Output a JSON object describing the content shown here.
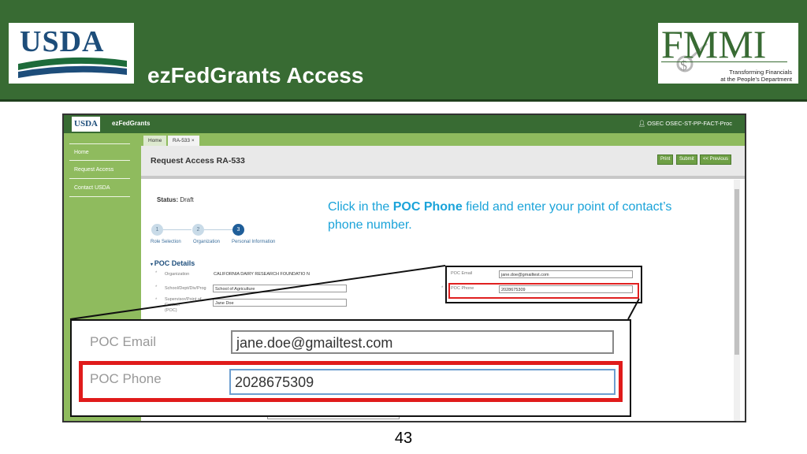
{
  "slide": {
    "title": "ezFedGrants Access",
    "page_number": "43",
    "usda_logo": "USDA",
    "fmmi_logo": "FMMI",
    "fmmi_tagline_1": "Transforming Financials",
    "fmmi_tagline_2": "at the People’s Department"
  },
  "app": {
    "logo": "USDA",
    "name": "ezFedGrants",
    "user": "OSEC OSEC-ST-PP-FACT-Proc",
    "sidebar": [
      "Home",
      "Request Access",
      "Contact USDA"
    ],
    "tabs": [
      "Home",
      "RA-533 ×"
    ],
    "page_title": "Request Access RA-533",
    "buttons": {
      "print": "Print",
      "submit": "Submit",
      "previous": "<< Previous"
    },
    "status_label": "Status:",
    "status_value": "Draft",
    "steps": [
      {
        "number": "1",
        "label": "Role Selection"
      },
      {
        "number": "2",
        "label": "Organization"
      },
      {
        "number": "3",
        "label": "Personal Information"
      }
    ],
    "poc_heading": "POC Details",
    "fields": {
      "organization_label": "Organization",
      "organization_value": "CALIFORNIA DAIRY RESEARCH FOUNDATIO N",
      "school_label": "School/Dept/Div/Prog",
      "school_value": "School of Agriculture",
      "supervisor_label_1": "Supervisor/Point of",
      "supervisor_label_2": "Contact",
      "supervisor_label_3": "(POC)",
      "supervisor_value": "Jane Doe",
      "poc_email_label": "POC Email",
      "poc_email_value": "jane.doe@gmailtest.com",
      "poc_phone_label": "POC Phone",
      "poc_phone_value": "2028675309"
    }
  },
  "instruction": {
    "before": "Click in the ",
    "bold": "POC Phone",
    "after": " field and enter your point of contact’s phone number."
  },
  "zoom": {
    "email_label": "POC Email",
    "email_value": "jane.doe@gmailtest.com",
    "phone_label": "POC Phone",
    "phone_value": "2028675309"
  },
  "colors": {
    "header_green": "#386b33",
    "sidebar_green": "#8fbb5e",
    "highlight_red": "#e01b1b",
    "instruction_blue": "#1aa3d9"
  }
}
